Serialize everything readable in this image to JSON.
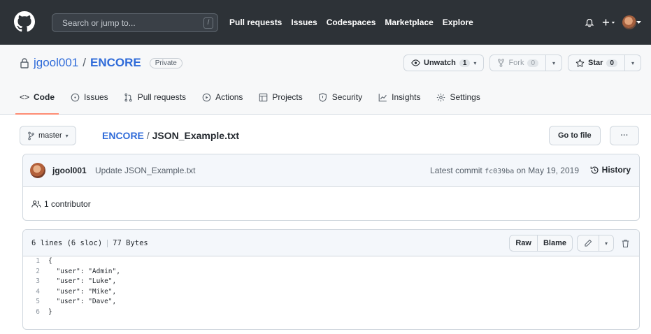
{
  "header": {
    "search_placeholder": "Search or jump to...",
    "search_shortcut": "/",
    "nav": [
      "Pull requests",
      "Issues",
      "Codespaces",
      "Marketplace",
      "Explore"
    ],
    "icons": [
      "bell-icon",
      "plus-icon",
      "avatar"
    ]
  },
  "repo": {
    "owner": "jgool001",
    "separator": "/",
    "name": "ENCORE",
    "visibility": "Private",
    "unwatch_label": "Unwatch",
    "unwatch_count": "1",
    "fork_label": "Fork",
    "fork_count": "0",
    "star_label": "Star",
    "star_count": "0"
  },
  "tabs": [
    "Code",
    "Issues",
    "Pull requests",
    "Actions",
    "Projects",
    "Security",
    "Insights",
    "Settings"
  ],
  "file_nav": {
    "branch": "master",
    "breadcrumb_root": "ENCORE",
    "breadcrumb_sep": "/",
    "file_name": "JSON_Example.txt",
    "go_to_file": "Go to file",
    "more": "···"
  },
  "commit": {
    "author": "jgool001",
    "message": "Update JSON_Example.txt",
    "latest_label": "Latest commit",
    "sha": "fc039ba",
    "date_text": "on May 19, 2019",
    "history_label": "History",
    "contributors": "1 contributor"
  },
  "file": {
    "lines_info": "6 lines (6 sloc)",
    "size": "77 Bytes",
    "raw_label": "Raw",
    "blame_label": "Blame",
    "code": [
      {
        "n": "1",
        "text": "{"
      },
      {
        "n": "2",
        "text": "  \"user\": \"Admin\","
      },
      {
        "n": "3",
        "text": "  \"user\": \"Luke\","
      },
      {
        "n": "4",
        "text": "  \"user\": \"Mike\","
      },
      {
        "n": "5",
        "text": "  \"user\": \"Dave\","
      },
      {
        "n": "6",
        "text": "}"
      }
    ]
  }
}
